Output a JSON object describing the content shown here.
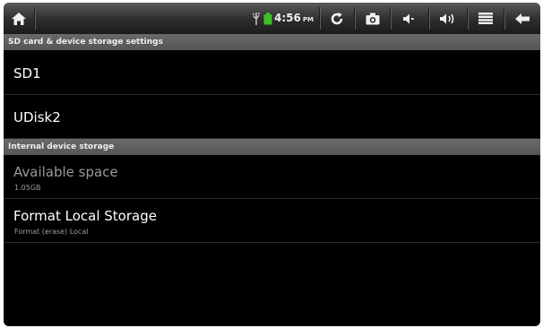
{
  "statusbar": {
    "time": "4:56",
    "ampm": "PM",
    "icons": [
      "home-icon",
      "usb-icon",
      "battery-icon",
      "refresh-icon",
      "camera-icon",
      "volume-down-icon",
      "volume-up-icon",
      "menu-icon",
      "back-icon"
    ],
    "battery_color": "#3fbf2a"
  },
  "sections": {
    "sd": {
      "header": "SD card & device storage settings",
      "items": [
        {
          "title": "SD1"
        },
        {
          "title": "UDisk2"
        }
      ]
    },
    "internal": {
      "header": "Internal device storage",
      "items": [
        {
          "title": "Available space",
          "summary": "1.05GB"
        },
        {
          "title": "Format Local Storage",
          "summary": "Format (erase) Local"
        }
      ]
    }
  }
}
